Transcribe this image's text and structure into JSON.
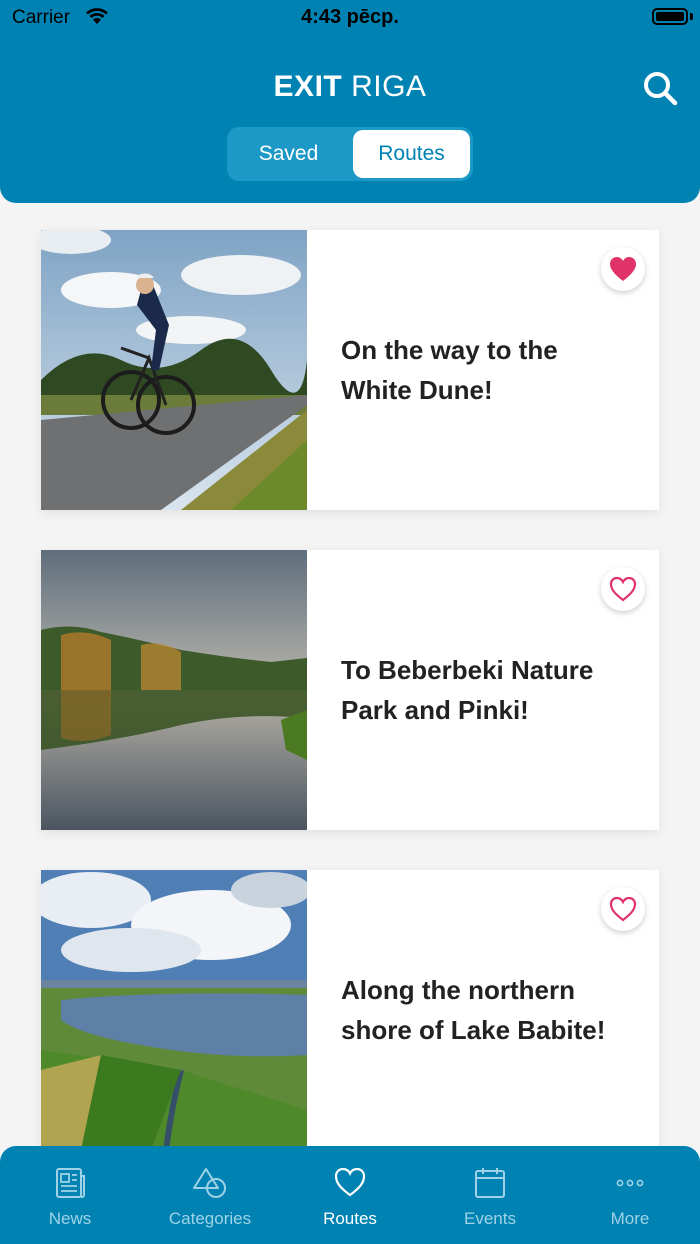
{
  "status_bar": {
    "carrier": "Carrier",
    "time": "4:43 pēcp."
  },
  "header": {
    "title_bold": "EXIT",
    "title_light": "RIGA"
  },
  "segmented": {
    "saved_label": "Saved",
    "routes_label": "Routes",
    "selected": "Routes"
  },
  "routes": [
    {
      "title": "On the way to the White Dune!",
      "favorited": true
    },
    {
      "title": "To Beberbeki Nature Park and Pinki!",
      "favorited": false
    },
    {
      "title": "Along the northern shore of Lake Babite!",
      "favorited": false
    }
  ],
  "tabbar": {
    "items": [
      {
        "label": "News",
        "icon": "newspaper-icon"
      },
      {
        "label": "Categories",
        "icon": "shapes-icon"
      },
      {
        "label": "Routes",
        "icon": "heart-icon"
      },
      {
        "label": "Events",
        "icon": "calendar-icon"
      },
      {
        "label": "More",
        "icon": "more-dots-icon"
      }
    ],
    "active": "Routes"
  },
  "colors": {
    "primary": "#0083b3",
    "heart": "#e0336a",
    "segment_bg": "#1c99c6"
  }
}
